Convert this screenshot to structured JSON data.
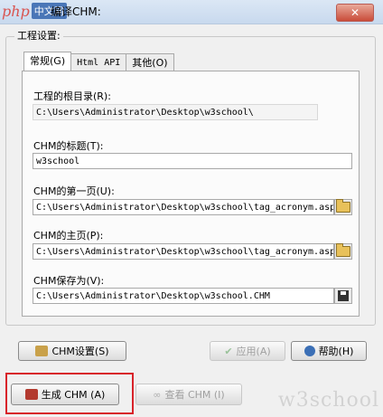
{
  "window": {
    "title": "编译CHM:",
    "close_label": "✕"
  },
  "logo": {
    "part1": "php",
    "part2": "中文网"
  },
  "group": {
    "label": "工程设置:"
  },
  "tabs": [
    "常规(G)",
    "Html API",
    "其他(O)"
  ],
  "fields": {
    "root": {
      "label": "工程的根目录(R):",
      "value": "C:\\Users\\Administrator\\Desktop\\w3school\\"
    },
    "title": {
      "label": "CHM的标题(T):",
      "value": "w3school"
    },
    "first_page": {
      "label": "CHM的第一页(U):",
      "value": "C:\\Users\\Administrator\\Desktop\\w3school\\tag_acronym.asp"
    },
    "home_page": {
      "label": "CHM的主页(P):",
      "value": "C:\\Users\\Administrator\\Desktop\\w3school\\tag_acronym.asp"
    },
    "save_as": {
      "label": "CHM保存为(V):",
      "value": "C:\\Users\\Administrator\\Desktop\\w3school.CHM"
    }
  },
  "buttons": {
    "chm_settings": "CHM设置(S)",
    "apply": "应用(A)",
    "help": "帮助(H)",
    "generate": "生成 CHM (A)",
    "view": "查看 CHM (I)"
  },
  "watermark": "w3school"
}
